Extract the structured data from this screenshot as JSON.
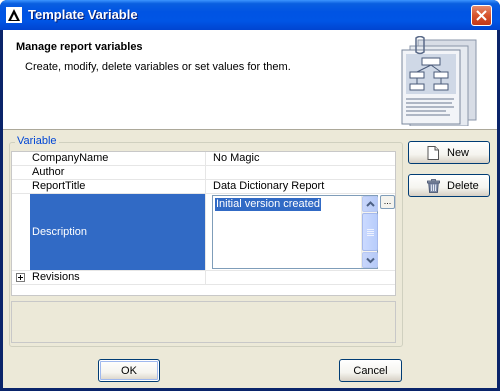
{
  "window": {
    "title": "Template Variable",
    "title_icon": "magicdraw-app-icon",
    "close_icon": "close-x-icon"
  },
  "header": {
    "title": "Manage report variables",
    "subtitle": "Create, modify, delete variables or set values for them.",
    "illustration": "report-documents-illustration"
  },
  "group": {
    "legend": "Variable"
  },
  "variables": [
    {
      "name": "CompanyName",
      "value": "No Magic"
    },
    {
      "name": "Author",
      "value": ""
    },
    {
      "name": "ReportTitle",
      "value": "Data Dictionary Report"
    },
    {
      "name": "Description",
      "value": "Initial version created"
    },
    {
      "name": "Revisions",
      "value": ""
    }
  ],
  "editor": {
    "ellipsis_label": "..."
  },
  "buttons": {
    "new": "New",
    "delete": "Delete",
    "ok": "OK",
    "cancel": "Cancel"
  },
  "colors": {
    "selection": "#316ac5",
    "titlebar": "#0054e3",
    "legend": "#0046d5",
    "dialog_bg": "#ece9d8"
  }
}
